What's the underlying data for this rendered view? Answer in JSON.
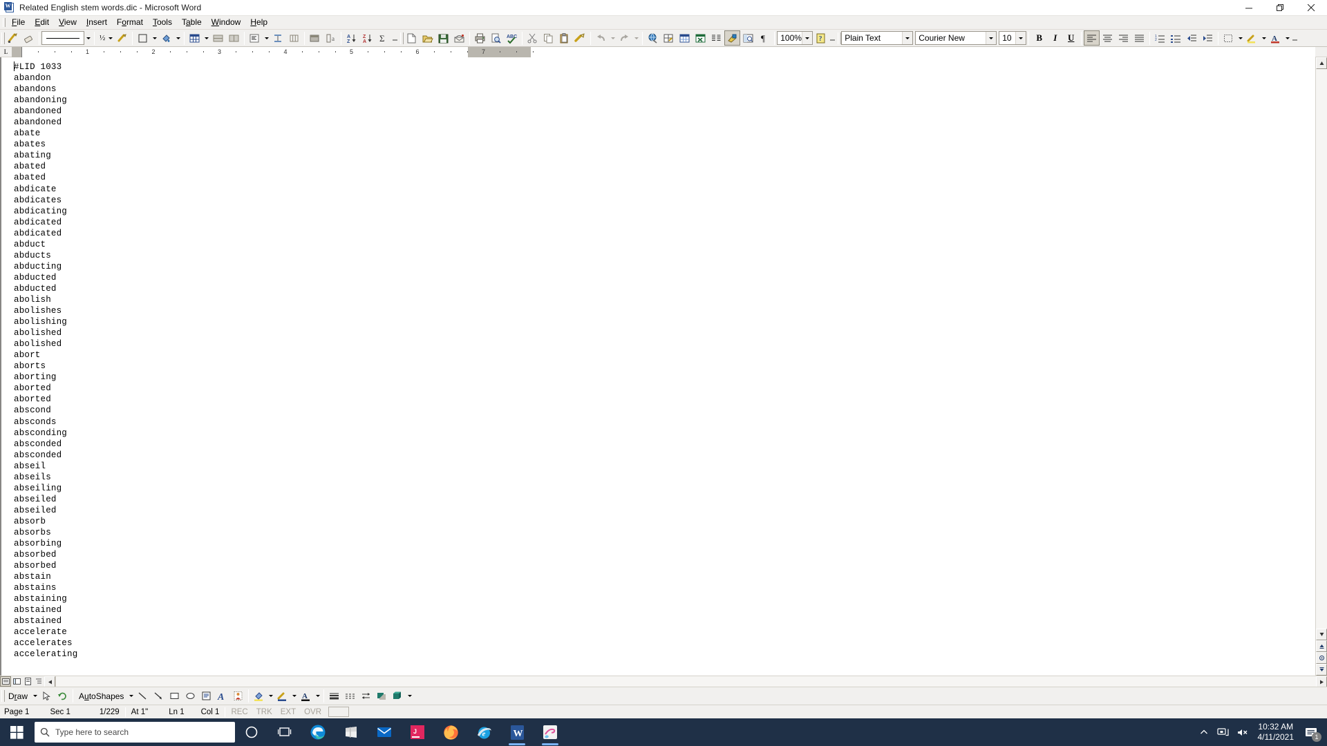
{
  "window": {
    "title": "Related English stem words.dic - Microsoft Word",
    "icon": "word-document-icon",
    "minimize_label": "Minimize",
    "restore_label": "Restore",
    "close_label": "Close"
  },
  "menubar": {
    "items": [
      {
        "label": "File",
        "accel": "F"
      },
      {
        "label": "Edit",
        "accel": "E"
      },
      {
        "label": "View",
        "accel": "V"
      },
      {
        "label": "Insert",
        "accel": "I"
      },
      {
        "label": "Format",
        "accel": "o"
      },
      {
        "label": "Tools",
        "accel": "T"
      },
      {
        "label": "Table",
        "accel": "a"
      },
      {
        "label": "Window",
        "accel": "W"
      },
      {
        "label": "Help",
        "accel": "H"
      }
    ]
  },
  "toolbar": {
    "tables_borders": [
      {
        "name": "draw-table-icon",
        "tip": "Draw Table"
      },
      {
        "name": "eraser-icon",
        "tip": "Eraser"
      },
      {
        "name": "line-style-combo",
        "tip": "Line Style"
      },
      {
        "name": "line-weight-icon",
        "tip": "Line Weight",
        "value": "½"
      },
      {
        "name": "border-color-icon",
        "tip": "Border Color"
      },
      {
        "name": "outside-border-icon",
        "tip": "Outside Border"
      },
      {
        "name": "shading-color-icon",
        "tip": "Shading Color"
      },
      {
        "name": "insert-table-icon",
        "tip": "Insert Table"
      },
      {
        "name": "merge-cells-icon",
        "tip": "Merge Cells"
      },
      {
        "name": "split-cells-icon",
        "tip": "Split Cells"
      },
      {
        "name": "align-cell-icon",
        "tip": "Align Top Left"
      },
      {
        "name": "distribute-rows-icon",
        "tip": "Distribute Rows Evenly"
      },
      {
        "name": "distribute-columns-icon",
        "tip": "Distribute Columns Evenly"
      },
      {
        "name": "table-autoformat-icon",
        "tip": "Table AutoFormat"
      },
      {
        "name": "change-text-direction-icon",
        "tip": "Change Text Direction"
      },
      {
        "name": "sort-ascending-icon",
        "tip": "Sort Ascending"
      },
      {
        "name": "sort-descending-icon",
        "tip": "Sort Descending"
      },
      {
        "name": "autosum-icon",
        "tip": "AutoSum"
      }
    ],
    "standard": [
      {
        "name": "new-document-icon",
        "tip": "New Blank Document"
      },
      {
        "name": "open-icon",
        "tip": "Open"
      },
      {
        "name": "save-icon",
        "tip": "Save"
      },
      {
        "name": "email-icon",
        "tip": "E-mail"
      },
      {
        "name": "print-icon",
        "tip": "Print"
      },
      {
        "name": "print-preview-icon",
        "tip": "Print Preview"
      },
      {
        "name": "spelling-grammar-icon",
        "tip": "Spelling and Grammar"
      },
      {
        "name": "cut-icon",
        "tip": "Cut"
      },
      {
        "name": "copy-icon",
        "tip": "Copy"
      },
      {
        "name": "paste-icon",
        "tip": "Paste"
      },
      {
        "name": "format-painter-icon",
        "tip": "Format Painter"
      },
      {
        "name": "undo-icon",
        "tip": "Undo"
      },
      {
        "name": "redo-icon",
        "tip": "Redo"
      },
      {
        "name": "insert-hyperlink-icon",
        "tip": "Insert Hyperlink"
      },
      {
        "name": "tables-and-borders-icon",
        "tip": "Tables and Borders"
      },
      {
        "name": "insert-table-icon",
        "tip": "Insert Table"
      },
      {
        "name": "insert-excel-spreadsheet-icon",
        "tip": "Insert Microsoft Excel Worksheet"
      },
      {
        "name": "columns-icon",
        "tip": "Columns"
      },
      {
        "name": "drawing-icon",
        "tip": "Drawing"
      },
      {
        "name": "document-map-icon",
        "tip": "Document Map"
      },
      {
        "name": "show-formatting-marks-icon",
        "tip": "Show/Hide ¶"
      }
    ],
    "zoom_value": "100%",
    "help": {
      "name": "microsoft-word-help-icon",
      "tip": "Microsoft Word Help"
    }
  },
  "formatting": {
    "style": "Plain Text",
    "font": "Courier New",
    "size": "10",
    "bold_label": "B",
    "italic_label": "I",
    "underline_label": "U",
    "buttons": [
      {
        "name": "align-left-button",
        "active": true
      },
      {
        "name": "align-center-button",
        "active": false
      },
      {
        "name": "align-right-button",
        "active": false
      },
      {
        "name": "justify-button",
        "active": false
      },
      {
        "name": "numbering-button",
        "active": false
      },
      {
        "name": "bullets-button",
        "active": false
      },
      {
        "name": "decrease-indent-button",
        "active": false
      },
      {
        "name": "increase-indent-button",
        "active": false
      },
      {
        "name": "outside-border-button",
        "active": false
      },
      {
        "name": "highlight-button",
        "active": false
      },
      {
        "name": "font-color-button",
        "active": false
      }
    ]
  },
  "ruler": {
    "tab_selector": "L",
    "numbers": [
      "1",
      "2",
      "3",
      "4",
      "5",
      "6",
      "7"
    ],
    "unit": "inch"
  },
  "document": {
    "lines": [
      "#LID 1033",
      "abandon",
      "abandons",
      "abandoning",
      "abandoned",
      "abandoned",
      "abate",
      "abates",
      "abating",
      "abated",
      "abated",
      "abdicate",
      "abdicates",
      "abdicating",
      "abdicated",
      "abdicated",
      "abduct",
      "abducts",
      "abducting",
      "abducted",
      "abducted",
      "abolish",
      "abolishes",
      "abolishing",
      "abolished",
      "abolished",
      "abort",
      "aborts",
      "aborting",
      "aborted",
      "aborted",
      "abscond",
      "absconds",
      "absconding",
      "absconded",
      "absconded",
      "abseil",
      "abseils",
      "abseiling",
      "abseiled",
      "abseiled",
      "absorb",
      "absorbs",
      "absorbing",
      "absorbed",
      "absorbed",
      "abstain",
      "abstains",
      "abstaining",
      "abstained",
      "abstained",
      "accelerate",
      "accelerates",
      "accelerating"
    ]
  },
  "view_buttons": [
    {
      "name": "normal-view-button",
      "active": true
    },
    {
      "name": "web-layout-view-button",
      "active": false
    },
    {
      "name": "print-layout-view-button",
      "active": false
    },
    {
      "name": "outline-view-button",
      "active": false
    }
  ],
  "drawing_toolbar": {
    "draw_label": "Draw",
    "draw_accel": "r",
    "autoshapes_label": "AutoShapes",
    "autoshapes_accel": "u",
    "items": [
      {
        "name": "select-objects-icon",
        "tip": "Select Objects"
      },
      {
        "name": "free-rotate-icon",
        "tip": "Free Rotate"
      },
      {
        "name": "line-icon",
        "tip": "Line"
      },
      {
        "name": "arrow-icon",
        "tip": "Arrow"
      },
      {
        "name": "rectangle-icon",
        "tip": "Rectangle"
      },
      {
        "name": "oval-icon",
        "tip": "Oval"
      },
      {
        "name": "text-box-icon",
        "tip": "Text Box"
      },
      {
        "name": "insert-wordart-icon",
        "tip": "Insert WordArt"
      },
      {
        "name": "insert-clip-art-icon",
        "tip": "Insert Clip Art"
      },
      {
        "name": "fill-color-icon",
        "tip": "Fill Color"
      },
      {
        "name": "line-color-icon",
        "tip": "Line Color"
      },
      {
        "name": "font-color-icon",
        "tip": "Font Color"
      },
      {
        "name": "line-style-icon",
        "tip": "Line Style"
      },
      {
        "name": "dash-style-icon",
        "tip": "Dash Style"
      },
      {
        "name": "arrow-style-icon",
        "tip": "Arrow Style"
      },
      {
        "name": "shadow-style-icon",
        "tip": "Shadow Style"
      },
      {
        "name": "3d-style-icon",
        "tip": "3-D Style"
      }
    ]
  },
  "statusbar": {
    "page": "Page 1",
    "section": "Sec 1",
    "page_count": "1/229",
    "at": "At 1\"",
    "line": "Ln 1",
    "col": "Col 1",
    "rec": "REC",
    "trk": "TRK",
    "ext": "EXT",
    "ovr": "OVR"
  },
  "taskbar": {
    "start": "start-button",
    "search_placeholder": "Type here to search",
    "items": [
      {
        "name": "cortana-icon"
      },
      {
        "name": "task-view-icon"
      },
      {
        "name": "microsoft-edge-icon"
      },
      {
        "name": "microsoft-store-icon"
      },
      {
        "name": "mail-icon"
      },
      {
        "name": "jetbrains-icon"
      },
      {
        "name": "firefox-icon"
      },
      {
        "name": "internet-explorer-icon"
      },
      {
        "name": "microsoft-word-icon",
        "open": true
      },
      {
        "name": "paint-icon",
        "open": true
      }
    ],
    "tray": [
      {
        "name": "show-hidden-icons-chevron"
      },
      {
        "name": "network-icon"
      },
      {
        "name": "volume-muted-icon"
      }
    ],
    "time": "10:32 AM",
    "date": "4/11/2021",
    "notification_count": "1"
  },
  "colors": {
    "taskbar_bg": "#1f3047",
    "chrome_bg": "#f1f0ee",
    "word_blue": "#2b579a",
    "accent_blue": "#316ac5"
  }
}
